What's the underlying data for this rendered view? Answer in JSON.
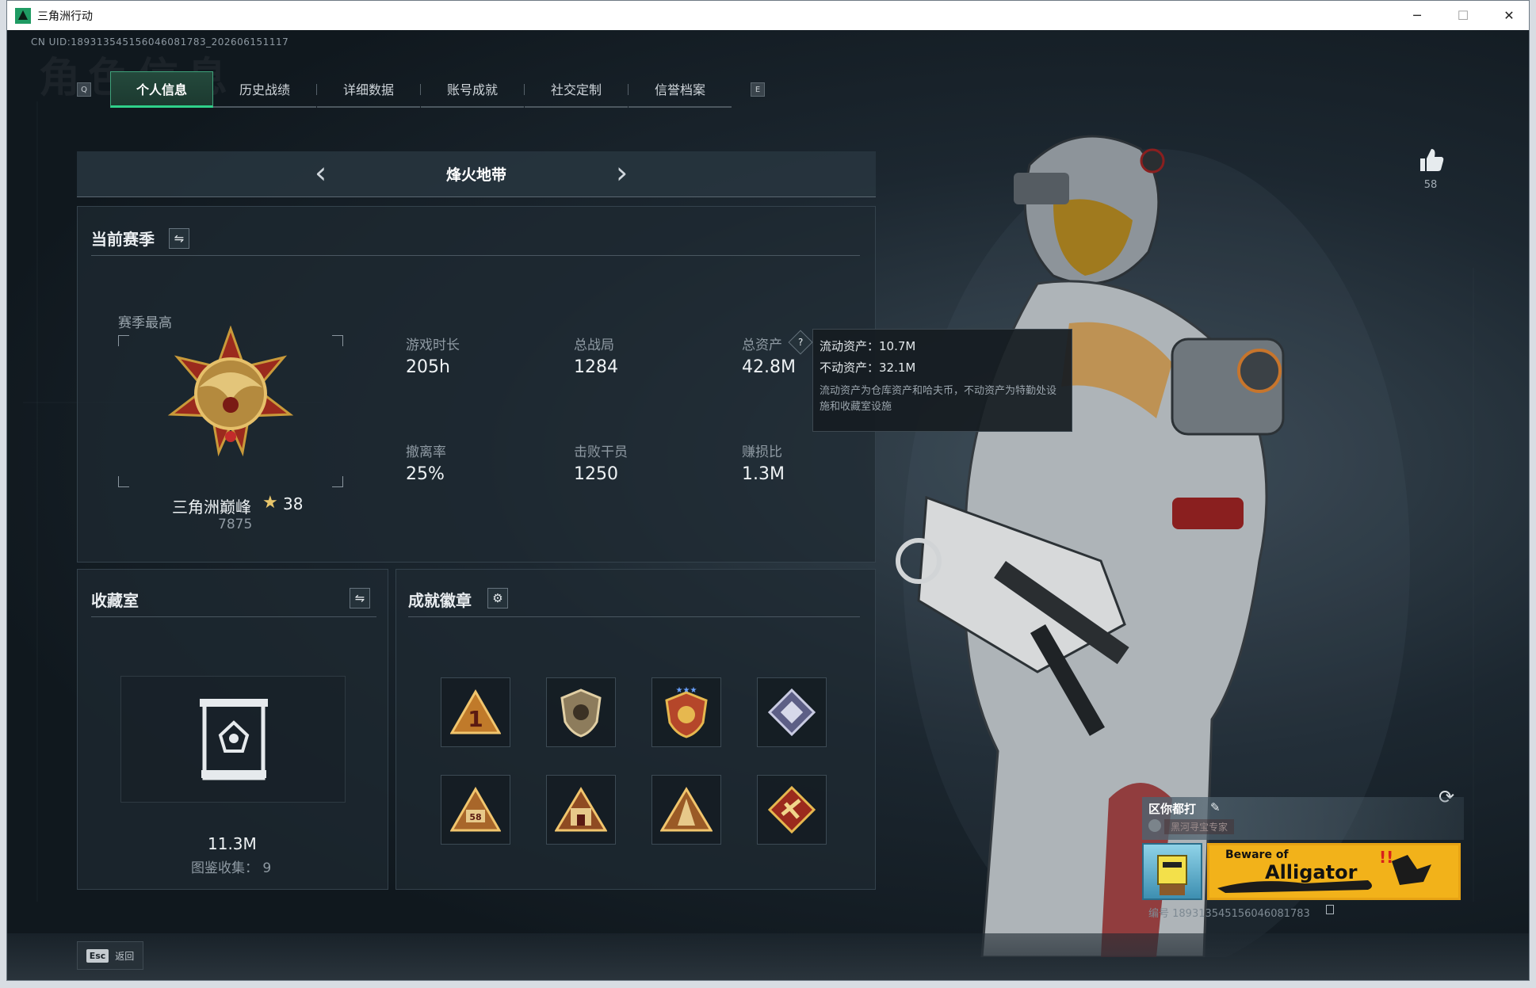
{
  "window": {
    "title": "三角洲行动",
    "minimize": "─",
    "maximize": "☐",
    "close": "✕"
  },
  "uid_text": "CN UID:189313545156046081783_202606151117",
  "bg_word": "角色信息",
  "tabs": {
    "left_key": "Q",
    "right_key": "E",
    "items": [
      "个人信息",
      "历史战绩",
      "详细数据",
      "账号成就",
      "社交定制",
      "信誉档案"
    ],
    "active_index": 0
  },
  "zone": {
    "title": "烽火地带",
    "prev": "‹",
    "next": "›"
  },
  "season": {
    "title": "当前赛季",
    "swap_icon": "⇋",
    "rank_label": "赛季最高",
    "rank_name": "三角洲巅峰",
    "rank_star": "★",
    "rank_stars_count": "38",
    "rank_score": "7875",
    "stats": [
      {
        "label": "游戏时长",
        "value": "205h"
      },
      {
        "label": "总战局",
        "value": "1284"
      },
      {
        "label": "总资产",
        "value": "42.8M"
      },
      {
        "label": "撤离率",
        "value": "25%"
      },
      {
        "label": "击败干员",
        "value": "1250"
      },
      {
        "label": "赚损比",
        "value": "1.3M"
      }
    ],
    "help_icon": "?"
  },
  "tooltip": {
    "line1": "流动资产：10.7M",
    "line2": "不动资产：32.1M",
    "desc": "流动资产为仓库资产和哈夫币，不动资产为特勤处设施和收藏室设施"
  },
  "collection": {
    "title": "收藏室",
    "swap_icon": "⇋",
    "value": "11.3M",
    "count_text": "图鉴收集： 9"
  },
  "badges": {
    "title": "成就徽章",
    "gear_icon": "⚙",
    "first_badge_text": "1",
    "second_row_badge_text": "58"
  },
  "like": {
    "count": "58"
  },
  "refresh_icon": "⟳",
  "player": {
    "name": "区你都打",
    "edit_icon": "✎",
    "title": "黑河寻宝专家",
    "banner_line1": "Beware of",
    "banner_line2": "Alligator",
    "id_text": "编号 189313545156046081783"
  },
  "footer": {
    "esc_key": "Esc",
    "back_label": "返回"
  },
  "colors": {
    "accent": "#2fd08a",
    "banner": "#f2b21a",
    "rank_gold": "#c99a3a",
    "badge_red": "#9b2a1d"
  }
}
